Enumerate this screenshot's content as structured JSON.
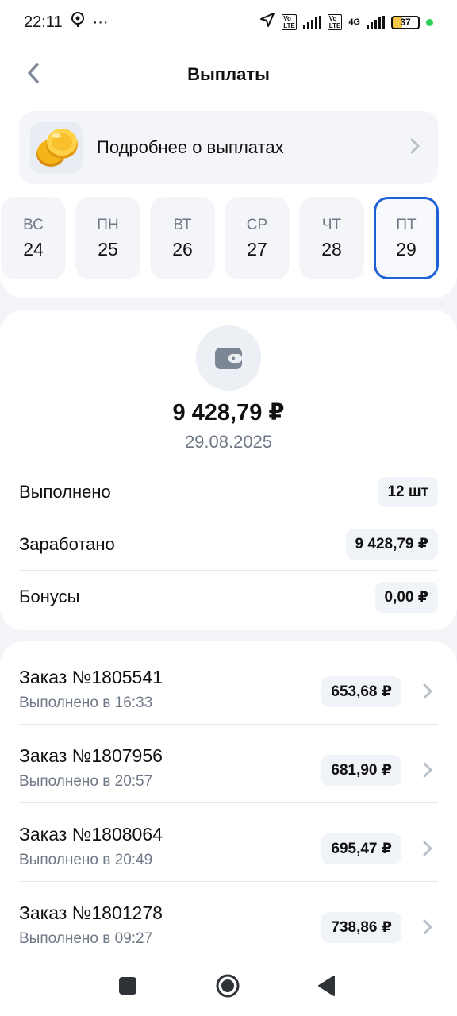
{
  "status_bar": {
    "time": "22:11",
    "dots": "···",
    "battery": "37",
    "network": "4G"
  },
  "header": {
    "title": "Выплаты"
  },
  "info_card": {
    "label": "Подробнее о выплатах"
  },
  "days": [
    {
      "name": "ВС",
      "num": "24",
      "active": false
    },
    {
      "name": "ПН",
      "num": "25",
      "active": false
    },
    {
      "name": "ВТ",
      "num": "26",
      "active": false
    },
    {
      "name": "СР",
      "num": "27",
      "active": false
    },
    {
      "name": "ЧТ",
      "num": "28",
      "active": false
    },
    {
      "name": "ПТ",
      "num": "29",
      "active": true
    }
  ],
  "summary": {
    "amount": "9 428,79 ₽",
    "date": "29.08.2025",
    "rows": [
      {
        "label": "Выполнено",
        "value": "12 шт"
      },
      {
        "label": "Заработано",
        "value": "9 428,79 ₽"
      },
      {
        "label": "Бонусы",
        "value": "0,00 ₽"
      }
    ]
  },
  "orders": [
    {
      "title": "Заказ №1805541",
      "subtitle": "Выполнено в 16:33",
      "amount": "653,68 ₽"
    },
    {
      "title": "Заказ №1807956",
      "subtitle": "Выполнено в 20:57",
      "amount": "681,90 ₽"
    },
    {
      "title": "Заказ №1808064",
      "subtitle": "Выполнено в 20:49",
      "amount": "695,47 ₽"
    },
    {
      "title": "Заказ №1801278",
      "subtitle": "Выполнено в 09:27",
      "amount": "738,86 ₽"
    }
  ],
  "colors": {
    "accent": "#1c62d6",
    "background": "#f2f4f7",
    "muted_text": "#6f7886"
  },
  "icons": {
    "back": "chevron-left-icon",
    "info": "coins-icon",
    "wallet": "wallet-icon",
    "row_chevron": "chevron-right-icon",
    "nav_recent": "square-icon",
    "nav_home": "circle-icon",
    "nav_back": "triangle-back-icon"
  }
}
